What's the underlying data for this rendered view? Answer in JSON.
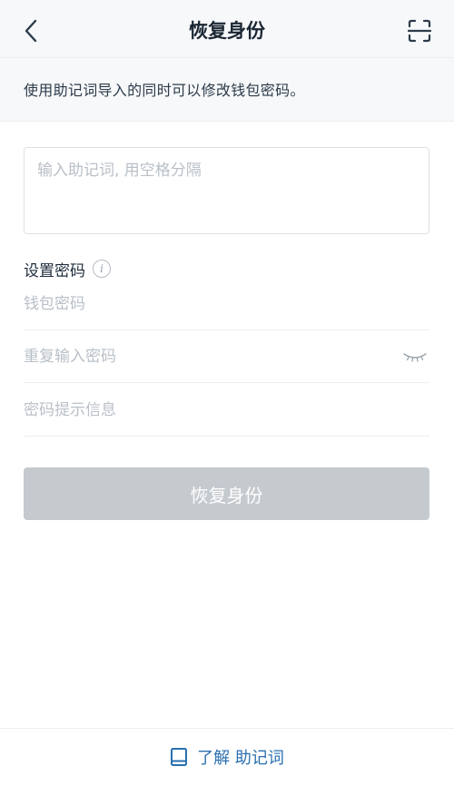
{
  "header": {
    "title": "恢复身份",
    "back_icon": "chevron-left-icon",
    "scan_icon": "scan-icon"
  },
  "notice": {
    "text": "使用助记词导入的同时可以修改钱包密码。"
  },
  "mnemonic": {
    "value": "",
    "placeholder": "输入助记词, 用空格分隔"
  },
  "password_section": {
    "label": "设置密码",
    "info_icon": "info-icon",
    "info_glyph": "i",
    "wallet_password": {
      "value": "",
      "placeholder": "钱包密码"
    },
    "repeat_password": {
      "value": "",
      "placeholder": "重复输入密码",
      "toggle_icon": "eye-closed-icon"
    },
    "password_hint": {
      "value": "",
      "placeholder": "密码提示信息"
    }
  },
  "submit": {
    "label": "恢复身份",
    "enabled": false
  },
  "footer": {
    "link_text": "了解 助记词",
    "icon": "book-icon"
  },
  "colors": {
    "link": "#2a6fb0",
    "button_disabled": "#c5cacf",
    "placeholder": "#b9c0c8",
    "header_bg": "#f7f8fa"
  }
}
